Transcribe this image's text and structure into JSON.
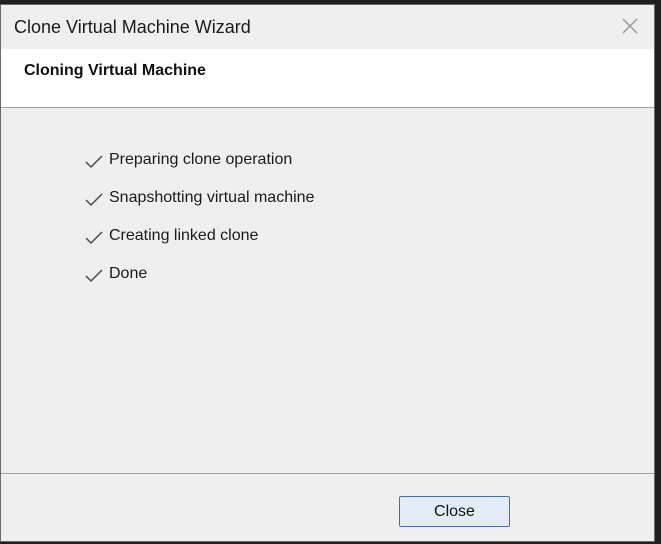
{
  "window": {
    "title": "Clone Virtual Machine Wizard"
  },
  "header": {
    "title": "Cloning Virtual Machine"
  },
  "steps": [
    {
      "label": "Preparing clone operation",
      "status": "done",
      "icon": "check-icon"
    },
    {
      "label": "Snapshotting virtual machine",
      "status": "done",
      "icon": "check-icon"
    },
    {
      "label": "Creating linked clone",
      "status": "done",
      "icon": "check-icon"
    },
    {
      "label": "Done",
      "status": "done",
      "icon": "check-icon"
    }
  ],
  "footer": {
    "close_label": "Close"
  },
  "colors": {
    "button_border": "#3a70b7",
    "button_fill": "#e3ecf6",
    "dialog_background": "#efefef",
    "header_background": "#ffffff"
  }
}
